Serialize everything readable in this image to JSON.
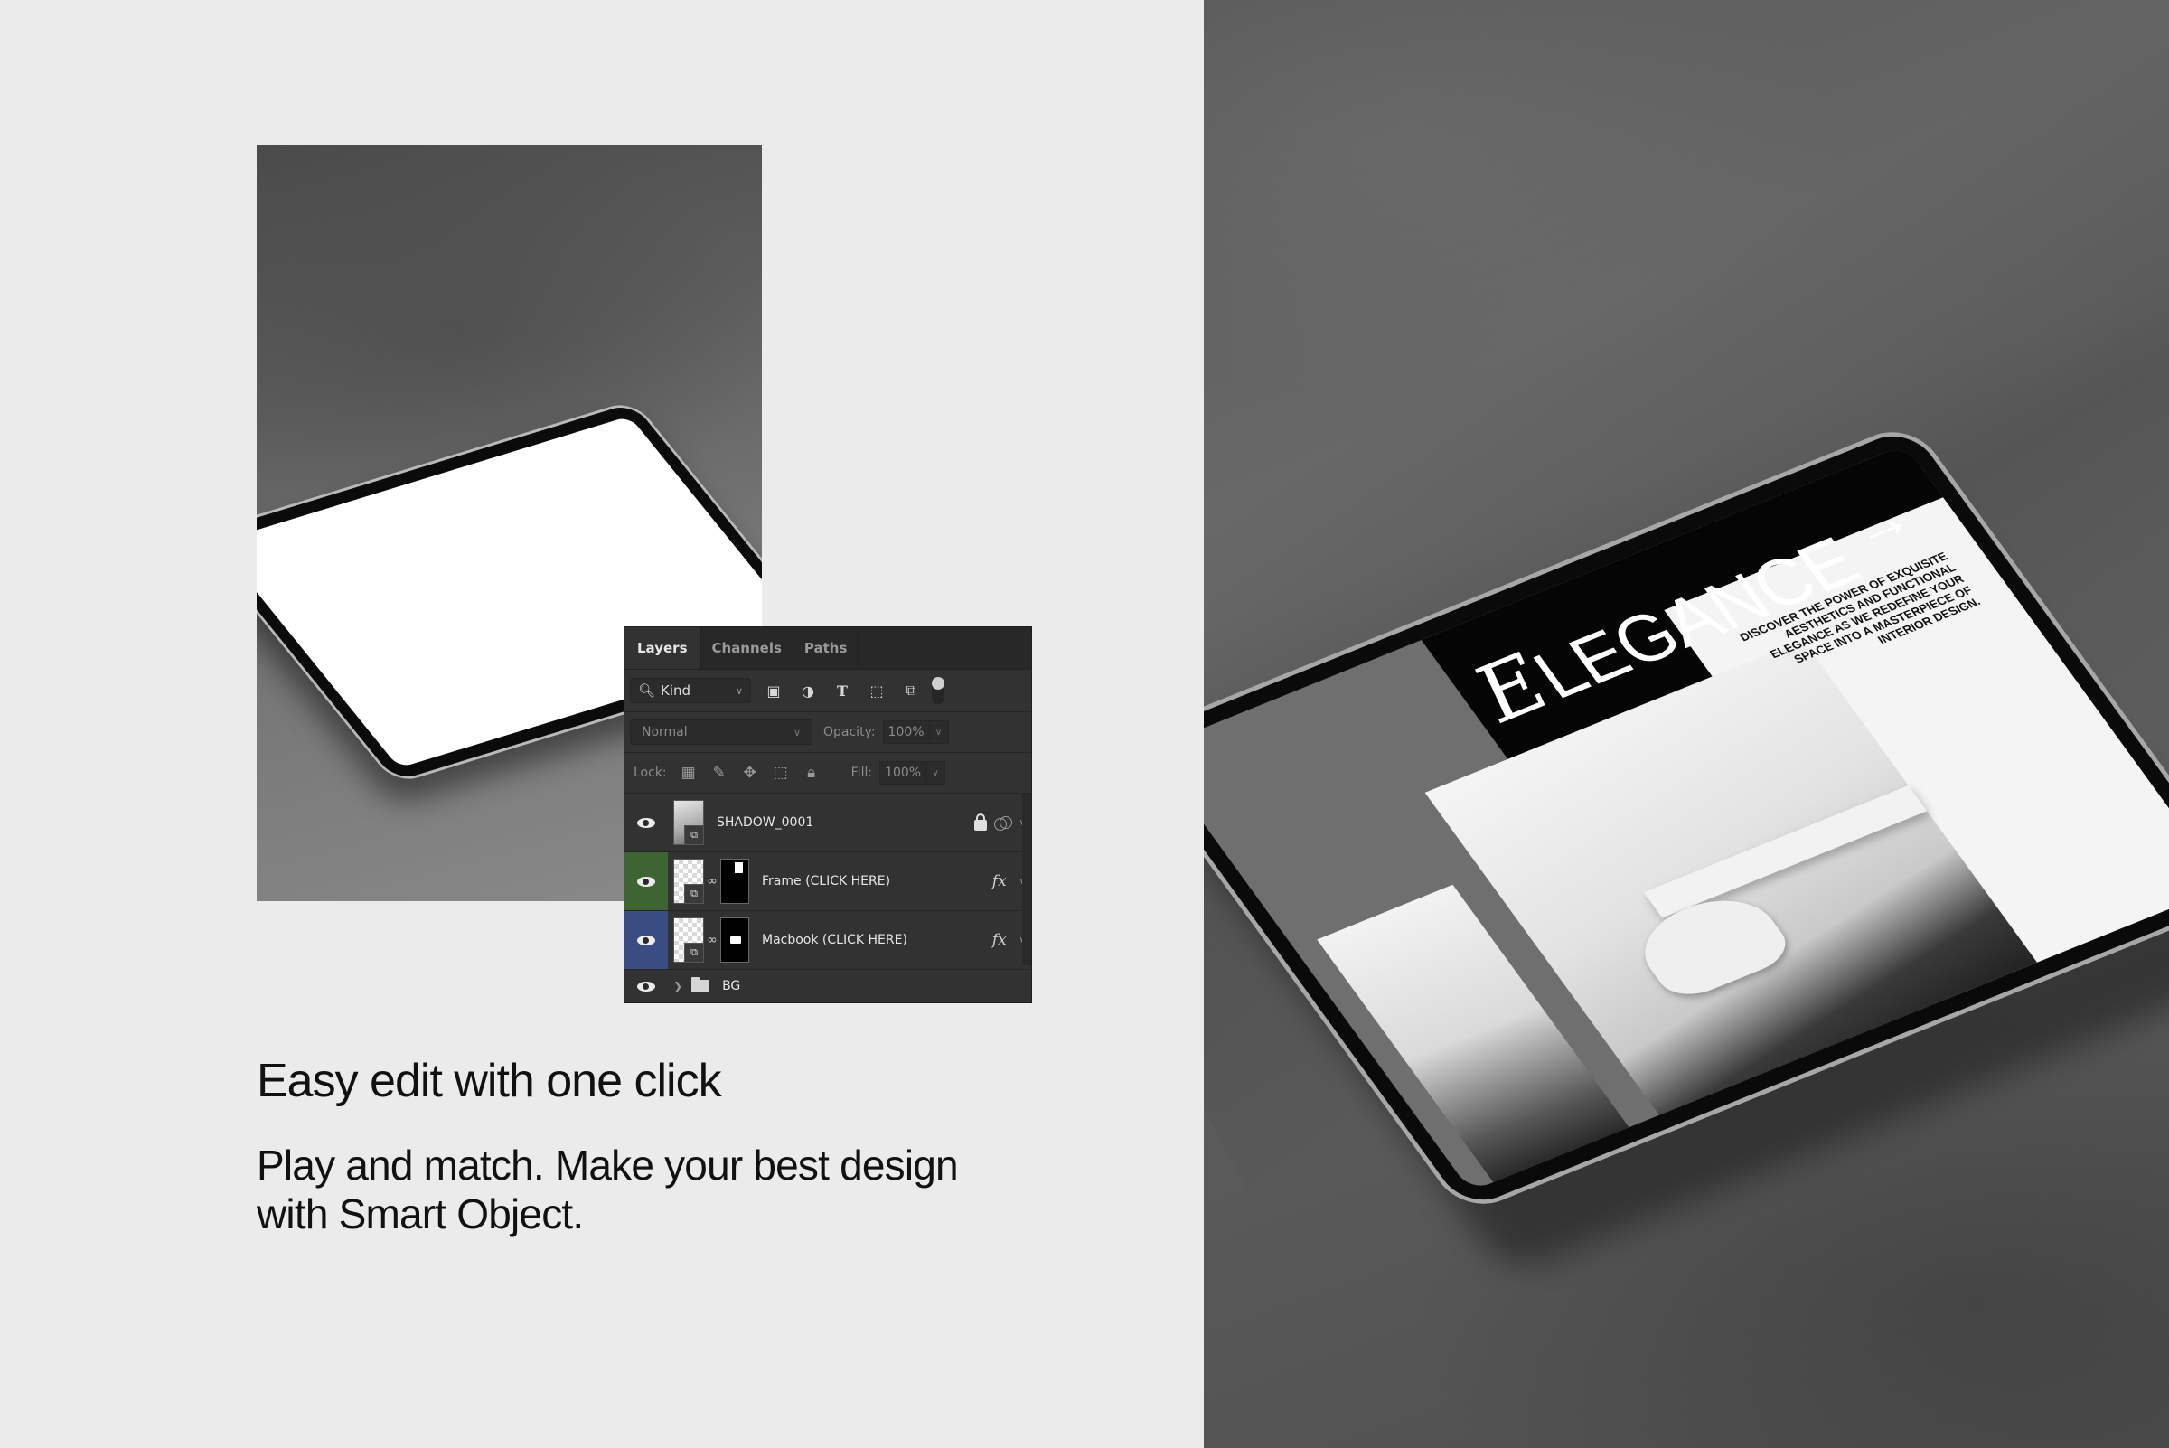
{
  "left": {
    "headline": "Easy edit with one click",
    "subcopy_line1": "Play and match. Make your best design",
    "subcopy_line2": "with Smart Object."
  },
  "layers_panel": {
    "tabs": [
      {
        "label": "Layers",
        "active": true
      },
      {
        "label": "Channels",
        "active": false
      },
      {
        "label": "Paths",
        "active": false
      }
    ],
    "filter": {
      "kind_label": "Kind",
      "icons": [
        "image-filter-icon",
        "adjustment-filter-icon",
        "type-filter-icon",
        "shape-filter-icon",
        "smart-object-filter-icon",
        "filter-toggle"
      ]
    },
    "blend_mode": "Normal",
    "opacity_label": "Opacity:",
    "opacity_value": "100%",
    "lock_label": "Lock:",
    "fill_label": "Fill:",
    "fill_value": "100%",
    "layers": [
      {
        "name": "SHADOW_0001",
        "visible": true,
        "locked": true,
        "highlight": "none"
      },
      {
        "name": "Frame (CLICK HERE)",
        "visible": true,
        "fx": "fx",
        "highlight": "green"
      },
      {
        "name": "Macbook (CLICK HERE)",
        "visible": true,
        "fx": "fx",
        "highlight": "blue"
      },
      {
        "name": "BG",
        "visible": true,
        "type": "group"
      }
    ]
  },
  "mockup_screen": {
    "title_initial": "E",
    "title_rest": "LEGANCE",
    "arrow": "→",
    "blurb": "Discover the power of exquisite aesthetics and functional elegance as we redefine your space into a masterpiece of interior design."
  },
  "colors": {
    "background": "#ebebeb",
    "panel": "#323232",
    "layer_green": "#3f6433",
    "layer_blue": "#3b4c82"
  }
}
